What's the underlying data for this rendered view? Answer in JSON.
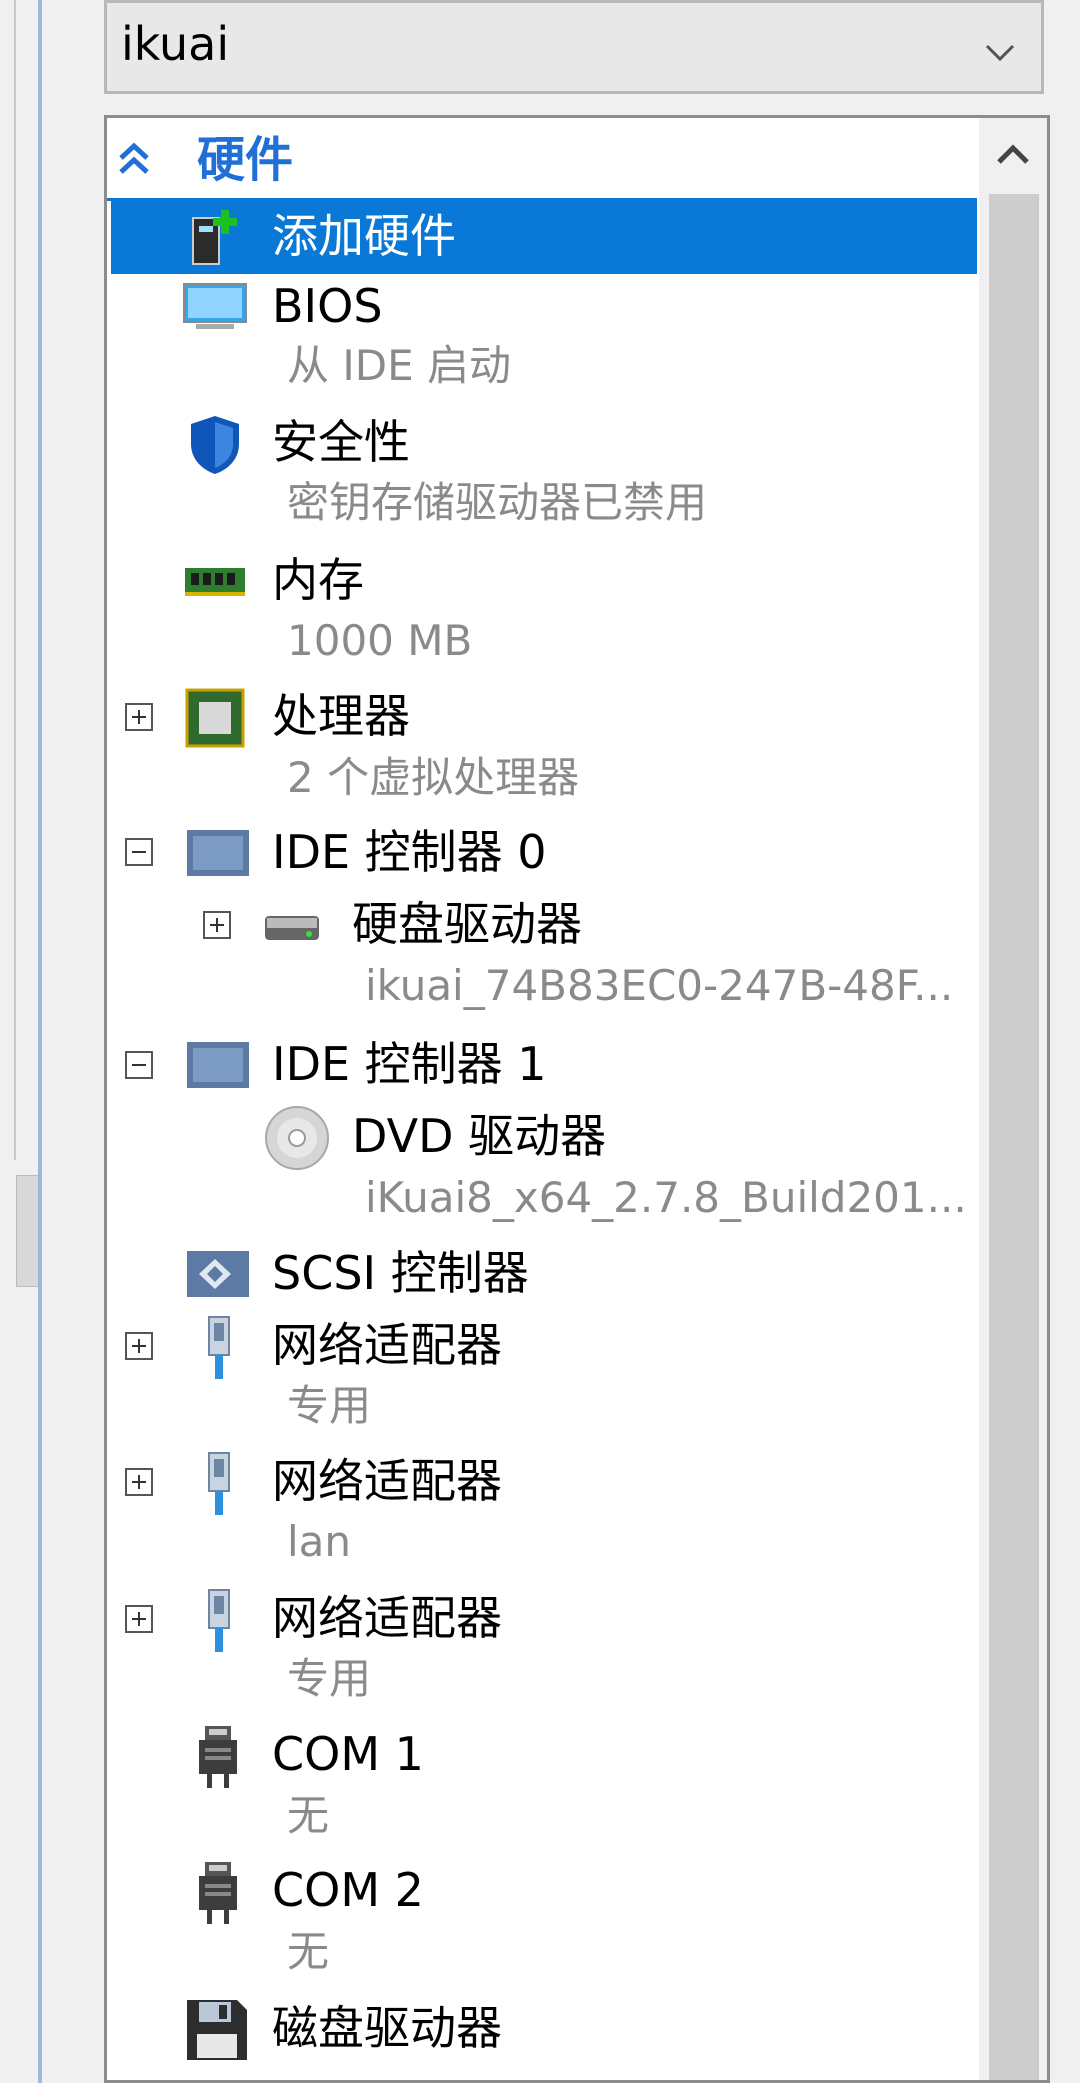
{
  "vm_selector": {
    "value": "ikuai"
  },
  "section": {
    "title": "硬件"
  },
  "items": [
    {
      "label": "添加硬件",
      "sub": ""
    },
    {
      "label": "BIOS",
      "sub": "从 IDE 启动"
    },
    {
      "label": "安全性",
      "sub": "密钥存储驱动器已禁用"
    },
    {
      "label": "内存",
      "sub": "1000 MB"
    },
    {
      "label": "处理器",
      "sub": "2 个虚拟处理器"
    },
    {
      "label": "IDE 控制器 0",
      "sub": ""
    },
    {
      "label": "硬盘驱动器",
      "sub": "ikuai_74B83EC0-247B-48F..."
    },
    {
      "label": "IDE 控制器 1",
      "sub": ""
    },
    {
      "label": "DVD 驱动器",
      "sub": "iKuai8_x64_2.7.8_Build201..."
    },
    {
      "label": "SCSI 控制器",
      "sub": ""
    },
    {
      "label": "网络适配器",
      "sub": "专用"
    },
    {
      "label": "网络适配器",
      "sub": "lan"
    },
    {
      "label": "网络适配器",
      "sub": "专用"
    },
    {
      "label": "COM 1",
      "sub": "无"
    },
    {
      "label": "COM 2",
      "sub": "无"
    },
    {
      "label": "磁盘驱动器",
      "sub": ""
    }
  ],
  "colors": {
    "accent": "#1f6fd6",
    "selection": "#0a78d7"
  }
}
